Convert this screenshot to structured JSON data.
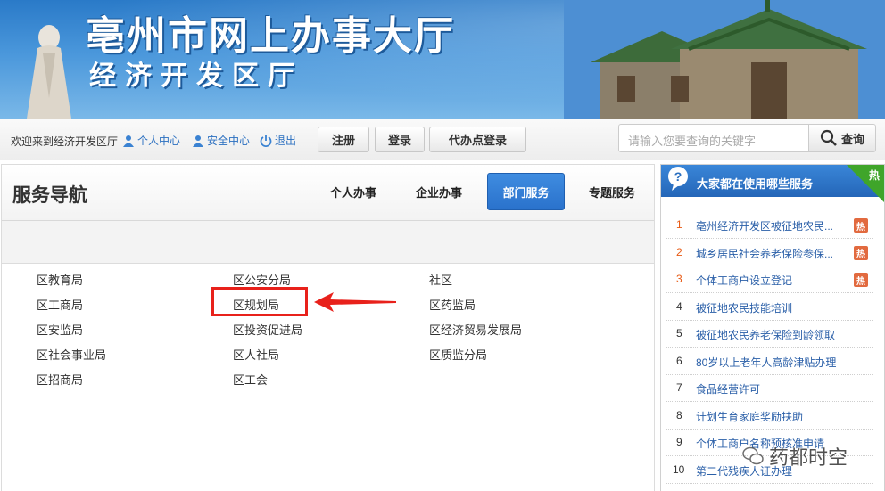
{
  "banner": {
    "title": "亳州市网上办事大厅",
    "subtitle": "经济开发区厅"
  },
  "topbar": {
    "welcome": "欢迎来到经济开发区厅",
    "personal_center": "个人中心",
    "security_center": "安全中心",
    "logout": "退出",
    "register": "注册",
    "login": "登录",
    "agent_login": "代办点登录",
    "search_placeholder": "请输入您要查询的关键字",
    "search_button": "查询"
  },
  "nav": {
    "title": "服务导航",
    "tabs": [
      {
        "label": "个人办事",
        "active": false
      },
      {
        "label": "企业办事",
        "active": false
      },
      {
        "label": "部门服务",
        "active": true
      },
      {
        "label": "专题服务",
        "active": false
      }
    ]
  },
  "departments": {
    "col1": [
      "区教育局",
      "区工商局",
      "区安监局",
      "区社会事业局",
      "区招商局"
    ],
    "col2": [
      "区公安分局",
      "区规划局",
      "区投资促进局",
      "区人社局",
      "区工会"
    ],
    "col3": [
      "社区",
      "区药监局",
      "区经济贸易发展局",
      "区质监分局"
    ]
  },
  "sidebar": {
    "title": "大家都在使用哪些服务",
    "hot_corner": "热",
    "hot_label": "热",
    "items": [
      {
        "rank": "1",
        "label": "亳州经济开发区被征地农民...",
        "hot": true
      },
      {
        "rank": "2",
        "label": "城乡居民社会养老保险参保...",
        "hot": true
      },
      {
        "rank": "3",
        "label": "个体工商户设立登记",
        "hot": true
      },
      {
        "rank": "4",
        "label": "被征地农民技能培训",
        "hot": false
      },
      {
        "rank": "5",
        "label": "被征地农民养老保险到龄领取",
        "hot": false
      },
      {
        "rank": "6",
        "label": "80岁以上老年人高龄津贴办理",
        "hot": false
      },
      {
        "rank": "7",
        "label": "食品经营许可",
        "hot": false
      },
      {
        "rank": "8",
        "label": "计划生育家庭奖励扶助",
        "hot": false
      },
      {
        "rank": "9",
        "label": "个体工商户名称预核准申请",
        "hot": false
      },
      {
        "rank": "10",
        "label": "第二代残疾人证办理",
        "hot": false
      }
    ]
  },
  "watermark": "药都时空",
  "colors": {
    "accent": "#2a72cc",
    "highlight": "#e8211b",
    "hot": "#e26a3f",
    "link": "#2a5fa8"
  }
}
